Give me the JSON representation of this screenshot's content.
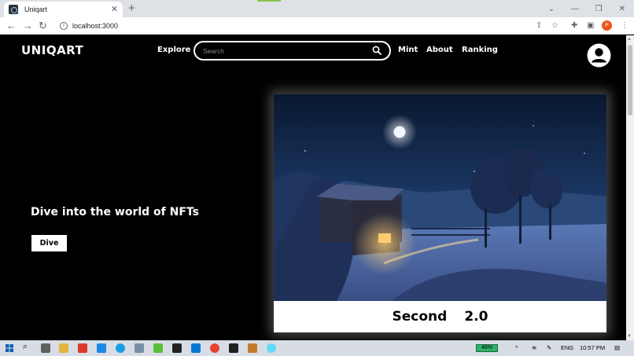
{
  "browser": {
    "tab_title": "Uniqart",
    "tab_close": "✕",
    "new_tab": "+",
    "url": "localhost:3000",
    "profile_initial": "P"
  },
  "header": {
    "logo": "UNIQART",
    "nav": {
      "explore": "Explore",
      "mint": "Mint",
      "about": "About",
      "ranking": "Ranking"
    },
    "search": {
      "placeholder": "Search",
      "value": ""
    }
  },
  "hero": {
    "title": "Dive into the world of NFTs",
    "button": "Dive"
  },
  "card": {
    "name": "Second",
    "version": "2.0"
  },
  "taskbar": {
    "battery": "48%",
    "language": "ENG",
    "time": "10:57 PM"
  }
}
